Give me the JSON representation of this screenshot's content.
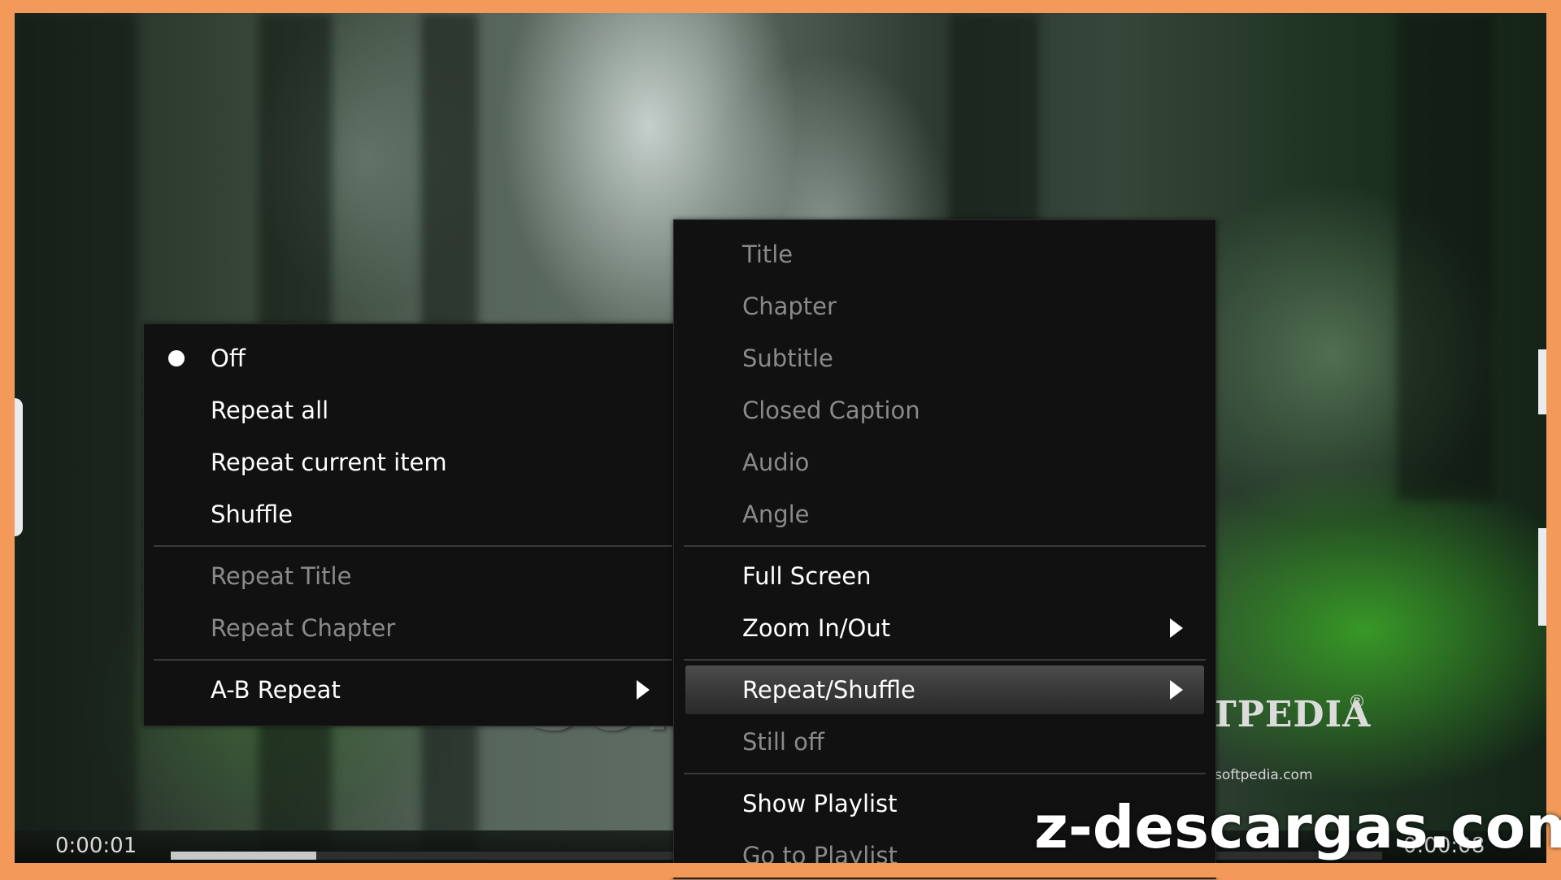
{
  "repeat_menu": {
    "items": [
      {
        "label": "Off",
        "selected": true,
        "enabled": true
      },
      {
        "label": "Repeat all",
        "enabled": true
      },
      {
        "label": "Repeat current item",
        "enabled": true
      },
      {
        "label": "Shuffle",
        "enabled": true
      },
      {
        "label": "Repeat Title",
        "enabled": false
      },
      {
        "label": "Repeat Chapter",
        "enabled": false
      },
      {
        "label": "A-B Repeat",
        "enabled": true,
        "submenu": true
      }
    ]
  },
  "main_menu": {
    "items": [
      {
        "label": "Title",
        "enabled": false
      },
      {
        "label": "Chapter",
        "enabled": false
      },
      {
        "label": "Subtitle",
        "enabled": false
      },
      {
        "label": "Closed Caption",
        "enabled": false
      },
      {
        "label": "Audio",
        "enabled": false
      },
      {
        "label": "Angle",
        "enabled": false
      },
      {
        "label": "Full Screen",
        "enabled": true
      },
      {
        "label": "Zoom In/Out",
        "enabled": true,
        "submenu": true
      },
      {
        "label": "Repeat/Shuffle",
        "enabled": true,
        "submenu": true,
        "highlighted": true
      },
      {
        "label": "Still off",
        "enabled": false
      },
      {
        "label": "Show Playlist",
        "enabled": true
      },
      {
        "label": "Go to Playlist",
        "enabled": false
      }
    ]
  },
  "player": {
    "current_time": "0:00:01",
    "total_time": "0:00:08",
    "progress": 0.12
  },
  "watermarks": {
    "softpedia_center": "SOFTPEDIA",
    "softpedia_corner": "TPEDIA",
    "softpedia_registered": "®",
    "softpedia_url": "softpedia.com",
    "site": "z-descargas.com"
  },
  "colors": {
    "frame": "#f39a5a",
    "menu_bg": "#111111",
    "menu_text": "#ffffff",
    "menu_disabled": "#8a8a8a",
    "highlight": "#3b3b3b"
  }
}
